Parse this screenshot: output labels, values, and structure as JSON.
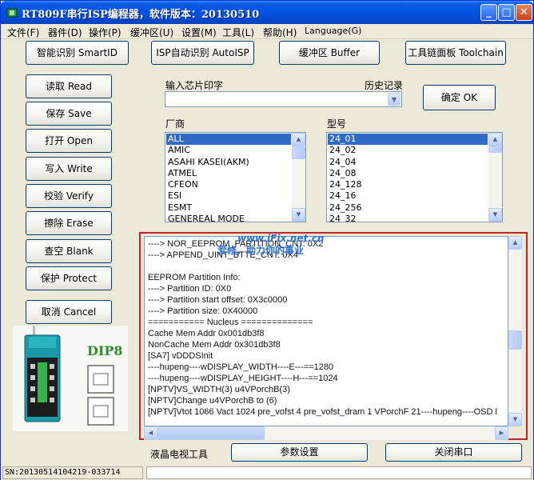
{
  "window": {
    "title": "RT809F串行ISP编程器，软件版本：20130510",
    "controls": {
      "minimize": "_",
      "maximize": "□",
      "close": "✕"
    }
  },
  "menu": [
    {
      "label": "文件(F)"
    },
    {
      "label": "器件(D)"
    },
    {
      "label": "操作(P)"
    },
    {
      "label": "缓冲区(U)"
    },
    {
      "label": "设置(M)"
    },
    {
      "label": "工具(L)"
    },
    {
      "label": "帮助(H)"
    },
    {
      "label": "Language(G)"
    }
  ],
  "top_buttons": {
    "smart_id": "智能识别 SmartID",
    "isp_auto": "ISP自动识别 AutoISP",
    "buffer": "缓冲区 Buffer",
    "toolchain": "工具链面板 Toolchain"
  },
  "left_buttons": {
    "read": "读取 Read",
    "save": "保存 Save",
    "open": "打开 Open",
    "write": "写入 Write",
    "verify": "校验 Verify",
    "erase": "擦除 Erase",
    "blank": "查空 Blank",
    "protect": "保护 Protect",
    "cancel": "取消 Cancel"
  },
  "chip_input": {
    "label": "输入芯片印字",
    "history_label": "历史记录",
    "value": "",
    "ok_button": "确定 OK"
  },
  "manufacturer": {
    "label": "厂商",
    "items": [
      "ALL",
      "AMIC",
      "ASAHI KASEI(AKM)",
      "ATMEL",
      "CFEON",
      "ESI",
      "ESMT",
      "GENEREAL MODE"
    ],
    "selected": 0
  },
  "model": {
    "label": "型号",
    "items": [
      "24_01",
      "24_02",
      "24_04",
      "24_08",
      "24_128",
      "24_16",
      "24_256",
      "24_32"
    ],
    "selected": 0
  },
  "log": {
    "lines": [
      "----> NOR_EEPROM_PARTITION_CNT: 0X2",
      "----> APPEND_UINT_BTTE_CNT: 0X4",
      "",
      "EEPROM Partition Info:",
      "----> Partition ID: 0X0",
      "----> Partition start offset: 0X3c0000",
      "----> Partition size: 0X40000",
      "=========== Nucleus ==============",
      "Cache   Mem Addr 0x001db3f8",
      "NonCache Mem Addr 0x301db3f8",
      "[SA7] vDDDSInit",
      "----hupeng----wDISPLAY_WIDTH----E---==1280",
      "----hupeng----wDISPLAY_HEIGHT----H---==1024",
      "[NPTV]VS_WIDTH(3) u4VPorchB(3)",
      "[NPTV]Change u4VPorchB to (6)",
      "[NPTV]Vtot 1066 Vact 1024 pre_vofst 4 pre_vofst_dram 1 VPorchF 21----hupeng----OSD l"
    ],
    "watermark_1": "www.iFix.net.cn",
    "watermark_2": "爱修，助力你的事业"
  },
  "bottom": {
    "lcd_tools_label": "液晶电视工具",
    "param_button": "参数设置",
    "close_port_button": "关闭串口"
  },
  "chip_image": {
    "label": "DIP8"
  },
  "statusbar": {
    "sn": "SN:20130514104219-033714",
    "panel_2": ""
  },
  "colors": {
    "title_bar": "#0054e3",
    "selection": "#316ac5",
    "log_frame": "#c0252b",
    "watermark": "#2a6fd6",
    "dip_label": "#2e8b2e"
  }
}
